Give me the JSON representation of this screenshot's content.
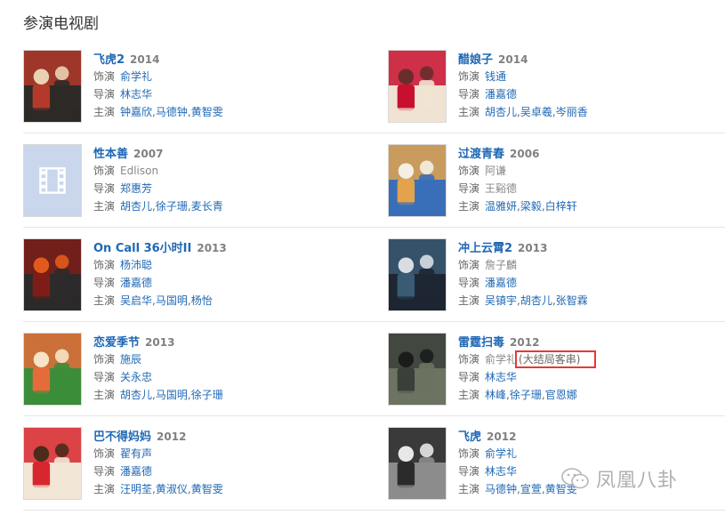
{
  "section_title": "参演电视剧",
  "labels": {
    "role": "饰演",
    "director": "导演",
    "cast": "主演"
  },
  "shows": [
    {
      "title": "飞虎2",
      "year": "2014",
      "role": "俞学礼",
      "role_linked": true,
      "director": "林志华",
      "director_linked": true,
      "cast": [
        "钟嘉欣",
        "马德钟",
        "黄智雯"
      ]
    },
    {
      "title": "醋娘子",
      "year": "2014",
      "role": "钱通",
      "role_linked": true,
      "director": "潘嘉德",
      "director_linked": true,
      "cast": [
        "胡杏儿",
        "吴卓羲",
        "岑丽香"
      ]
    },
    {
      "title": "性本善",
      "year": "2007",
      "role": "Edlison",
      "role_linked": false,
      "director": "郑惠芳",
      "director_linked": true,
      "cast": [
        "胡杏儿",
        "徐子珊",
        "麦长青"
      ]
    },
    {
      "title": "过渡青春",
      "year": "2006",
      "role": "阿谦",
      "role_linked": false,
      "director": "王谿德",
      "director_linked": false,
      "cast": [
        "温雅妍",
        "梁毅",
        "白梓轩"
      ]
    },
    {
      "title": "On Call 36小时II",
      "year": "2013",
      "role": "杨沛聪",
      "role_linked": true,
      "director": "潘嘉德",
      "director_linked": true,
      "cast": [
        "吴启华",
        "马国明",
        "杨怡"
      ]
    },
    {
      "title": "冲上云霄2",
      "year": "2013",
      "role": "詹子麟",
      "role_linked": false,
      "director": "潘嘉德",
      "director_linked": true,
      "cast": [
        "吴镇宇",
        "胡杏儿",
        "张智霖"
      ]
    },
    {
      "title": "恋爱季节",
      "year": "2013",
      "role": "施辰",
      "role_linked": true,
      "director": "关永忠",
      "director_linked": true,
      "cast": [
        "胡杏儿",
        "马国明",
        "徐子珊"
      ]
    },
    {
      "title": "雷霆扫毒",
      "year": "2012",
      "role": "俞学礼",
      "role_linked": false,
      "role_note": "(大结局客串)",
      "director": "林志华",
      "director_linked": true,
      "cast": [
        "林峰",
        "徐子珊",
        "官恩娜"
      ]
    },
    {
      "title": "巴不得妈妈",
      "year": "2012",
      "role": "翟有声",
      "role_linked": true,
      "director": "潘嘉德",
      "director_linked": true,
      "cast": [
        "汪明荃",
        "黄淑仪",
        "黄智雯"
      ]
    },
    {
      "title": "飞虎",
      "year": "2012",
      "role": "俞学礼",
      "role_linked": true,
      "director": "林志华",
      "director_linked": true,
      "cast": [
        "马德钟",
        "宣萱",
        "黄智雯"
      ]
    }
  ],
  "posters": [
    {
      "icon": "poster-feihu2",
      "palette": [
        "#b33a2a",
        "#2d2a27",
        "#e9d2b3"
      ]
    },
    {
      "icon": "poster-cuniangzi",
      "palette": [
        "#c8102e",
        "#f0e3d3",
        "#6b2c2c"
      ]
    },
    {
      "icon": "film-placeholder-icon",
      "palette": [
        "#c9d6ec",
        "#aebfde",
        "#ffffff"
      ]
    },
    {
      "icon": "poster-guoduqingchun",
      "palette": [
        "#e3a34c",
        "#3a6fb8",
        "#f4efe4"
      ]
    },
    {
      "icon": "poster-oncall36",
      "palette": [
        "#7e1d17",
        "#2c2a2a",
        "#e25a1b"
      ]
    },
    {
      "icon": "poster-chongshangyunxiao2",
      "palette": [
        "#3a5b74",
        "#1e2633",
        "#d8dde2"
      ]
    },
    {
      "icon": "poster-lianaijijie",
      "palette": [
        "#e46b3a",
        "#3c8d3a",
        "#f6e3c8"
      ]
    },
    {
      "icon": "poster-leitingsaodu",
      "palette": [
        "#3b3f3a",
        "#6c7361",
        "#1a1c1b"
      ]
    },
    {
      "icon": "poster-babudemama",
      "palette": [
        "#d7262d",
        "#f2e6d6",
        "#4b2b1a"
      ]
    },
    {
      "icon": "poster-feihu",
      "palette": [
        "#2b2b2b",
        "#8c8c8c",
        "#e8e8e8"
      ]
    }
  ],
  "highlight_color": "#e53935",
  "link_color": "#1f68b5",
  "watermark": {
    "text": "凤凰八卦",
    "icon": "wechat-icon"
  }
}
